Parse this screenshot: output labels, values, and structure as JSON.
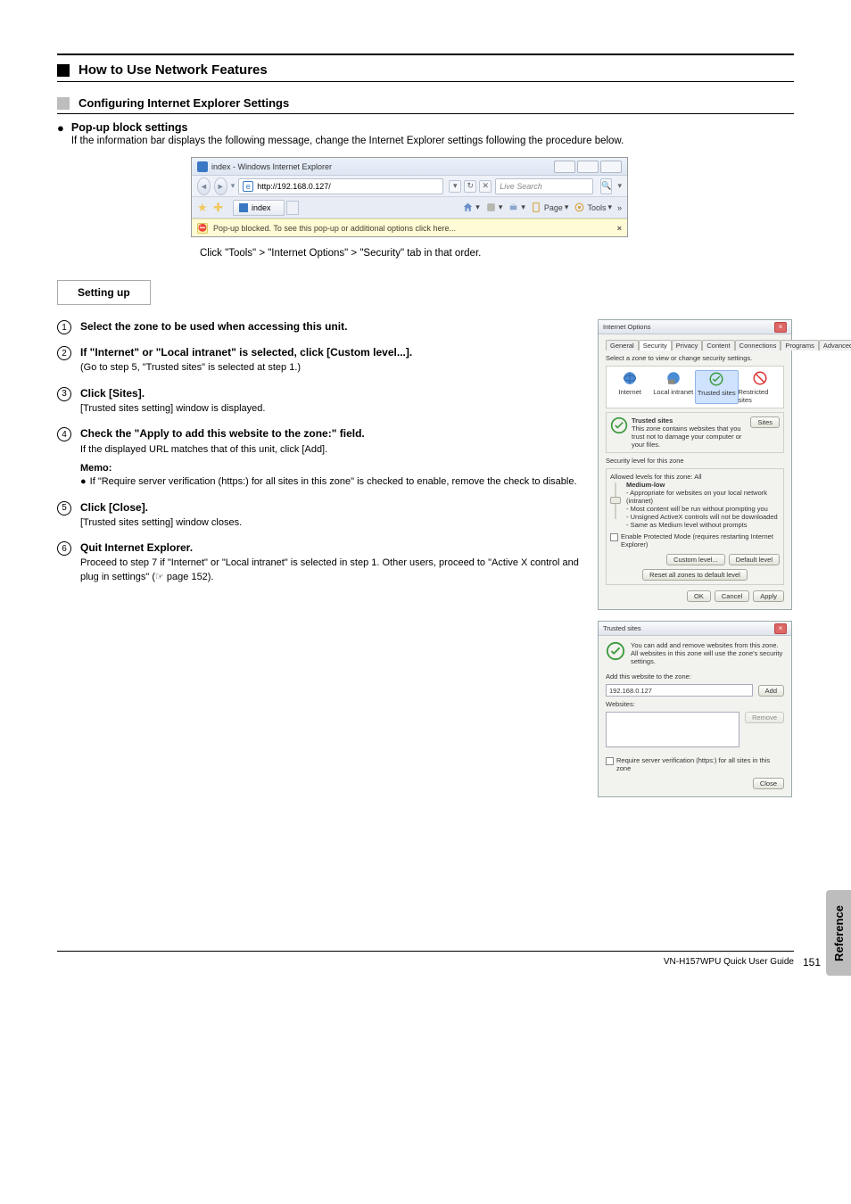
{
  "section": {
    "title": "How to Use Network Features",
    "subTitle": "Configuring Internet Explorer Settings",
    "bulletTitle": "Pop-up block settings",
    "bulletDesc": "If the information bar displays the following message, change the Internet Explorer settings following the procedure below.",
    "screenshotBelow": "Click \"Tools\" > \"Internet Options\" > \"Security\" tab in that order."
  },
  "ie": {
    "windowTitle": "index - Windows Internet Explorer",
    "url": "http://192.168.0.127/",
    "searchPlaceholder": "Live Search",
    "tabName": "index",
    "toolbar": {
      "page": "Page",
      "tools": "Tools"
    },
    "infoBar": "Pop-up blocked. To see this pop-up or additional options click here...",
    "infoClose": "×"
  },
  "settingUp": "Setting up",
  "steps": [
    {
      "n": "1",
      "head": "Select the zone to be used when accessing this unit."
    },
    {
      "n": "2",
      "head": "If \"Internet\" or \"Local intranet\" is selected, click [Custom level...].",
      "body": "(Go to step 5, \"Trusted sites\" is selected at step 1.)"
    },
    {
      "n": "3",
      "head": "Click [Sites].",
      "body": "[Trusted sites setting] window is displayed."
    },
    {
      "n": "4",
      "head": "Check the \"Apply to add this website to the zone:\" field.",
      "body": "If the displayed URL matches that of this unit, click [Add].",
      "note": {
        "label": "Memo:",
        "text": "If \"Require server verification (https:) for all sites in this zone\" is checked to enable, remove the check to disable."
      }
    },
    {
      "n": "5",
      "head": "Click [Close].",
      "body": "[Trusted sites setting] window closes."
    },
    {
      "n": "6",
      "head": "Quit Internet Explorer.",
      "body": "Proceed to step 7 if \"Internet\" or \"Local intranet\" is selected in step 1. Other users, proceed to \"Active X control and plug in settings\" (☞ page 152)."
    }
  ],
  "internetOptions": {
    "title": "Internet Options",
    "tabs": [
      "General",
      "Security",
      "Privacy",
      "Content",
      "Connections",
      "Programs",
      "Advanced"
    ],
    "selectZone": "Select a zone to view or change security settings.",
    "zones": [
      "Internet",
      "Local intranet",
      "Trusted sites",
      "Restricted sites"
    ],
    "trustedHead": "Trusted sites",
    "trustedDesc": "This zone contains websites that you trust not to damage your computer or your files.",
    "sitesBtn": "Sites",
    "secLevelHead": "Security level for this zone",
    "allowed": "Allowed levels for this zone: All",
    "medLow": "Medium-low",
    "medLowLines": [
      "- Appropriate for websites on your local network (intranet)",
      "- Most content will be run without prompting you",
      "- Unsigned ActiveX controls will not be downloaded",
      "- Same as Medium level without prompts"
    ],
    "protectedMode": "Enable Protected Mode (requires restarting Internet Explorer)",
    "customBtn": "Custom level...",
    "defaultBtn": "Default level",
    "resetBtn": "Reset all zones to default level",
    "ok": "OK",
    "cancel": "Cancel",
    "apply": "Apply"
  },
  "trustedSites": {
    "title": "Trusted sites",
    "intro": "You can add and remove websites from this zone. All websites in this zone will use the zone's security settings.",
    "addLabel": "Add this website to the zone:",
    "addValue": "192.168.0.127",
    "addBtn": "Add",
    "websitesLabel": "Websites:",
    "removeBtn": "Remove",
    "requireHttps": "Require server verification (https:) for all sites in this zone",
    "closeBtn": "Close"
  },
  "sideTab": "Reference",
  "footer": {
    "text": "VN-H157WPU Quick User Guide",
    "page": "151"
  }
}
